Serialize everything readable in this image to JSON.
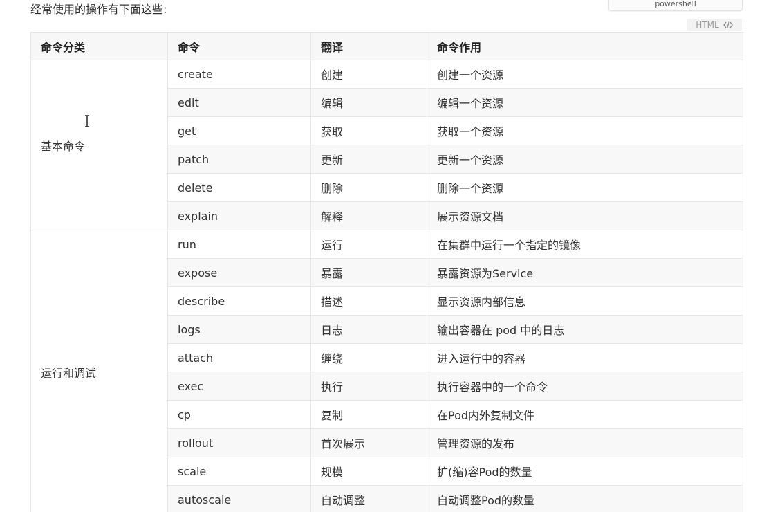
{
  "intro_text": "经常使用的操作有下面这些:",
  "top_button_label": "powershell",
  "code_lang": "HTML",
  "table": {
    "headers": [
      "命令分类",
      "命令",
      "翻译",
      "命令作用"
    ],
    "groups": [
      {
        "category": "基本命令",
        "rows": [
          {
            "cmd": "create",
            "trans": "创建",
            "desc": "创建一个资源"
          },
          {
            "cmd": "edit",
            "trans": "编辑",
            "desc": "编辑一个资源"
          },
          {
            "cmd": "get",
            "trans": "获取",
            "desc": "获取一个资源"
          },
          {
            "cmd": "patch",
            "trans": "更新",
            "desc": "更新一个资源"
          },
          {
            "cmd": "delete",
            "trans": "删除",
            "desc": "删除一个资源"
          },
          {
            "cmd": "explain",
            "trans": "解释",
            "desc": "展示资源文档"
          }
        ]
      },
      {
        "category": "运行和调试",
        "rows": [
          {
            "cmd": "run",
            "trans": "运行",
            "desc": "在集群中运行一个指定的镜像"
          },
          {
            "cmd": "expose",
            "trans": "暴露",
            "desc": "暴露资源为Service"
          },
          {
            "cmd": "describe",
            "trans": "描述",
            "desc": "显示资源内部信息"
          },
          {
            "cmd": "logs",
            "trans": "日志",
            "desc": "输出容器在 pod 中的日志"
          },
          {
            "cmd": "attach",
            "trans": "缠绕",
            "desc": "进入运行中的容器"
          },
          {
            "cmd": "exec",
            "trans": "执行",
            "desc": "执行容器中的一个命令"
          },
          {
            "cmd": "cp",
            "trans": "复制",
            "desc": "在Pod内外复制文件"
          },
          {
            "cmd": "rollout",
            "trans": "首次展示",
            "desc": "管理资源的发布"
          },
          {
            "cmd": "scale",
            "trans": "规模",
            "desc": "扩(缩)容Pod的数量"
          },
          {
            "cmd": "autoscale",
            "trans": "自动调整",
            "desc": "自动调整Pod的数量"
          }
        ]
      }
    ]
  }
}
